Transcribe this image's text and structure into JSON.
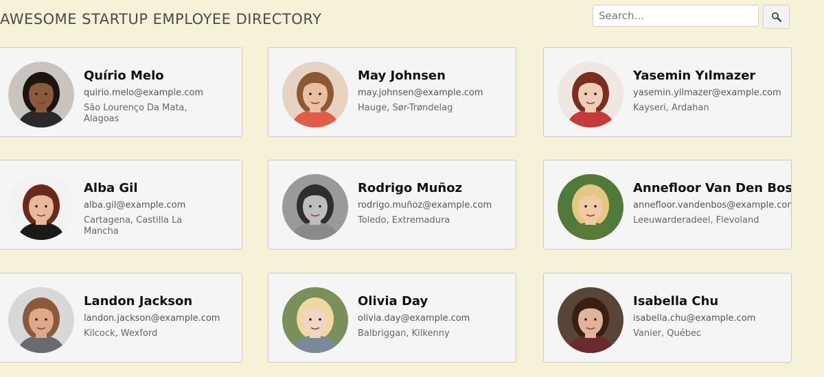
{
  "header": {
    "title": "AWESOME STARTUP EMPLOYEE DIRECTORY"
  },
  "search": {
    "placeholder": "Search...",
    "button_icon": "search-icon"
  },
  "employees": [
    {
      "name": "Quírio Melo",
      "email": "quirio.melo@example.com",
      "location": "São Lourenço Da Mata, Alagoas",
      "skin": "#8a5a3c",
      "hair": "#1c1410",
      "shirt": "#2a2a2a",
      "bg": "#c9c4bd"
    },
    {
      "name": "May Johnsen",
      "email": "may.johnsen@example.com",
      "location": "Hauge, Sør-Trøndelag",
      "skin": "#e9c0a0",
      "hair": "#8a5a34",
      "shirt": "#e25c4a",
      "bg": "#e8d3c2"
    },
    {
      "name": "Yasemin Yılmazer",
      "email": "yasemin.yilmazer@example.com",
      "location": "Kayseri, Ardahan",
      "skin": "#f0cdb8",
      "hair": "#7a2e20",
      "shirt": "#c33b3b",
      "bg": "#efe7e2"
    },
    {
      "name": "Alba Gil",
      "email": "alba.gil@example.com",
      "location": "Cartagena, Castilla La Mancha",
      "skin": "#e8b89a",
      "hair": "#6a2a1a",
      "shirt": "#1a1a1a",
      "bg": "#f2f2f2"
    },
    {
      "name": "Rodrigo Muñoz",
      "email": "rodrigo.muñoz@example.com",
      "location": "Toledo, Extremadura",
      "skin": "#bdbdbd",
      "hair": "#2e2e2e",
      "shirt": "#8a8a8a",
      "bg": "#9a9a9a"
    },
    {
      "name": "Annefloor Van Den Bos",
      "email": "annefloor.vandenbos@example.com",
      "location": "Leeuwarderadeel, Flevoland",
      "skin": "#f0c9a6",
      "hair": "#e4c780",
      "shirt": "#5a7a3a",
      "bg": "#4f7a3a"
    },
    {
      "name": "Landon Jackson",
      "email": "landon.jackson@example.com",
      "location": "Kilcock, Wexford",
      "skin": "#e0a88a",
      "hair": "#8a5a3a",
      "shirt": "#6a6a72",
      "bg": "#d8d8d8"
    },
    {
      "name": "Olivia Day",
      "email": "olivia.day@example.com",
      "location": "Balbriggan, Kilkenny",
      "skin": "#f0d6c6",
      "hair": "#efd9a0",
      "shirt": "#7a8a9a",
      "bg": "#7a8f5a"
    },
    {
      "name": "Isabella Chu",
      "email": "isabella.chu@example.com",
      "location": "Vanier, Québec",
      "skin": "#e0b49a",
      "hair": "#3a1f16",
      "shirt": "#6a2a30",
      "bg": "#5a4438"
    }
  ]
}
